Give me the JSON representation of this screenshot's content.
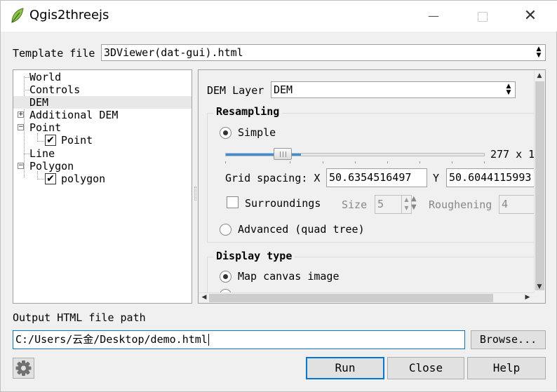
{
  "window": {
    "title": "Qgis2threejs",
    "minimize_glyph": "—",
    "close_glyph": "✕"
  },
  "template": {
    "label": "Template file",
    "value": "3DViewer(dat-gui).html"
  },
  "tree": {
    "items": [
      {
        "label": "World"
      },
      {
        "label": "Controls"
      },
      {
        "label": "DEM",
        "selected": true
      },
      {
        "label": "Additional DEM"
      },
      {
        "label": "Point"
      },
      {
        "label": "Point",
        "checked": true
      },
      {
        "label": "Line"
      },
      {
        "label": "Polygon"
      },
      {
        "label": "polygon",
        "checked": true
      }
    ]
  },
  "dem": {
    "layer_label": "DEM Layer",
    "layer_value": "DEM",
    "resampling": {
      "title": "Resampling",
      "simple_label": "Simple",
      "simple_selected": true,
      "size_text": "277 x 1",
      "slider_fraction": 0.24,
      "grid_label": "Grid spacing: X",
      "grid_x": "50.6354516497",
      "grid_y_label": "Y",
      "grid_y": "50.6044115993",
      "surroundings_label": "Surroundings",
      "surroundings_checked": false,
      "size_label": "Size",
      "size_value": "5",
      "roughening_label": "Roughening",
      "roughening_value": "4",
      "advanced_label": "Advanced (quad tree)"
    },
    "display": {
      "title": "Display type",
      "map_canvas_label": "Map canvas image",
      "map_canvas_selected": true
    }
  },
  "output": {
    "label": "Output HTML file path",
    "value": "C:/Users/云金/Desktop/demo.html",
    "browse_label": "Browse..."
  },
  "buttons": {
    "run": "Run",
    "close": "Close",
    "help": "Help"
  },
  "icons": {
    "app": "qgis-leaf-icon",
    "settings": "gear-icon"
  },
  "colors": {
    "accent": "#0078d7",
    "slider": "#3a8ed8",
    "app_icon": "#8bc34a"
  }
}
